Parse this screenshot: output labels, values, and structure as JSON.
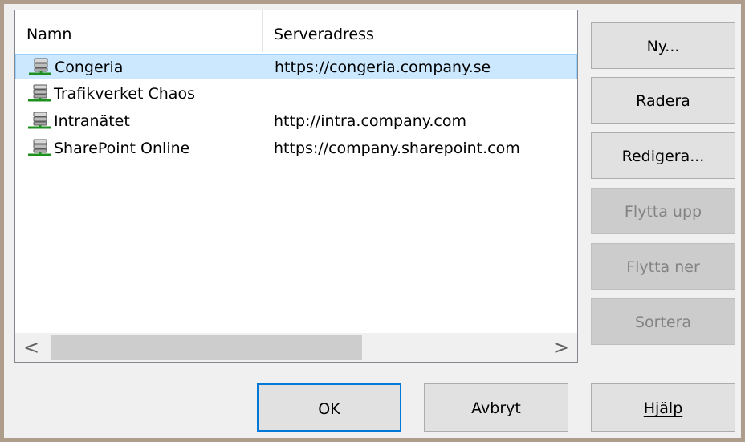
{
  "list": {
    "columns": [
      "Namn",
      "Serveradress"
    ],
    "rows": [
      {
        "name": "Congeria",
        "address": "https://congeria.company.se",
        "selected": true
      },
      {
        "name": "Trafikverket Chaos",
        "address": ""
      },
      {
        "name": "Intranätet",
        "address": "http://intra.company.com"
      },
      {
        "name": "SharePoint Online",
        "address": "https://company.sharepoint.com"
      }
    ],
    "row_icon": "server-icon",
    "scroll": {
      "left_glyph": "<",
      "right_glyph": ">"
    }
  },
  "side_buttons": {
    "new_label": "Ny...",
    "delete_label": "Radera",
    "edit_label": "Redigera...",
    "move_up_label": "Flytta upp",
    "move_down_label": "Flytta ner",
    "sort_label": "Sortera"
  },
  "footer": {
    "ok_label": "OK",
    "cancel_label": "Avbryt",
    "help_label": "Hjälp"
  },
  "colors": {
    "frame": "#ad9d8a",
    "selection_fill": "#cce8ff",
    "selection_border": "#99d1ff",
    "default_button_border": "#0078d7"
  }
}
